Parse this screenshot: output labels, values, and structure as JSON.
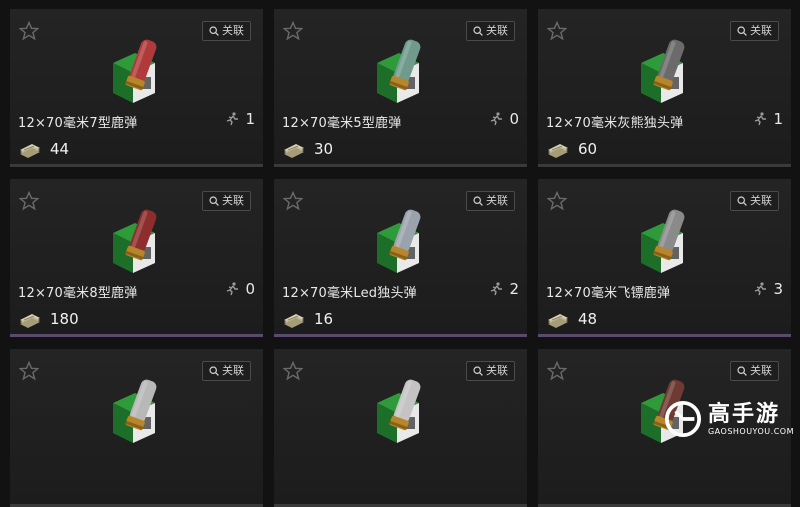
{
  "link_label": "关联",
  "items": [
    {
      "name": "12×70毫米7型鹿弹",
      "count": "1",
      "price": "44",
      "shell_color": "#b03a3a"
    },
    {
      "name": "12×70毫米5型鹿弹",
      "count": "0",
      "price": "30",
      "shell_color": "#6f9a8c"
    },
    {
      "name": "12×70毫米灰熊独头弹",
      "count": "1",
      "price": "60",
      "shell_color": "#6b6b6b"
    },
    {
      "name": "12×70毫米8型鹿弹",
      "count": "0",
      "price": "180",
      "shell_color": "#8e2d2d"
    },
    {
      "name": "12×70毫米Led独头弹",
      "count": "2",
      "price": "16",
      "shell_color": "#9aa3ab"
    },
    {
      "name": "12×70毫米飞镖鹿弹",
      "count": "3",
      "price": "48",
      "shell_color": "#8a8a8a"
    },
    {
      "name": "",
      "count": "",
      "price": "",
      "shell_color": "#b8b8b8"
    },
    {
      "name": "",
      "count": "",
      "price": "",
      "shell_color": "#c4c4c4"
    },
    {
      "name": "",
      "count": "",
      "price": "",
      "shell_color": "#6e3a32"
    }
  ],
  "watermark": {
    "brand_cn": "高手游",
    "brand_en": "GAOSHOUYOU.COM"
  }
}
